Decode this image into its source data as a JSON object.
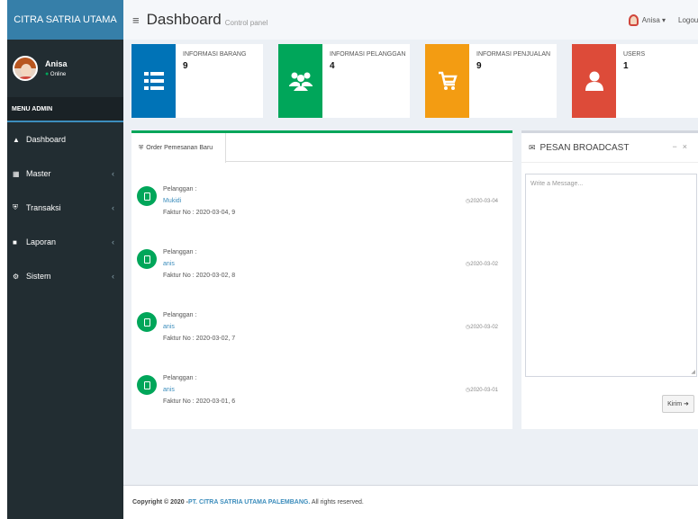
{
  "sidebar": {
    "brand": "CITRA SATRIA UTAMA",
    "user": {
      "name": "Anisa",
      "status": "Online"
    },
    "menu_header": "MENU ADMIN",
    "items": [
      {
        "label": "Dashboard",
        "icon": "dashboard-icon",
        "has_submenu": false
      },
      {
        "label": "Master",
        "icon": "th-icon",
        "has_submenu": true
      },
      {
        "label": "Transaksi",
        "icon": "cart-icon",
        "has_submenu": true
      },
      {
        "label": "Laporan",
        "icon": "book-icon",
        "has_submenu": true
      },
      {
        "label": "Sistem",
        "icon": "gear-icon",
        "has_submenu": true
      }
    ]
  },
  "header": {
    "title": "Dashboard",
    "subtitle": "Control panel",
    "user_label": "Anisa ▾",
    "logout_label": "Logout"
  },
  "info_boxes": [
    {
      "title": "INFORMASI BARANG",
      "value": "9",
      "color": "#0073b7",
      "icon": "list-icon"
    },
    {
      "title": "INFORMASI PELANGGAN",
      "value": "4",
      "color": "#00a65a",
      "icon": "users-icon"
    },
    {
      "title": "INFORMASI PENJUALAN",
      "value": "9",
      "color": "#f39c12",
      "icon": "cart-icon"
    },
    {
      "title": "USERS",
      "value": "1",
      "color": "#dd4b39",
      "icon": "user-icon"
    }
  ],
  "orders": {
    "tab_label": "Order Pemesanan Baru",
    "items": [
      {
        "label": "Pelanggan :",
        "name": "Mukidi",
        "faktur": "Faktur No : 2020-03-04, 9",
        "date": "2020-03-04"
      },
      {
        "label": "Pelanggan :",
        "name": "anis",
        "faktur": "Faktur No : 2020-03-02, 8",
        "date": "2020-03-02"
      },
      {
        "label": "Pelanggan :",
        "name": "anis",
        "faktur": "Faktur No : 2020-03-02, 7",
        "date": "2020-03-02"
      },
      {
        "label": "Pelanggan :",
        "name": "anis",
        "faktur": "Faktur No : 2020-03-01, 6",
        "date": "2020-03-01"
      }
    ]
  },
  "broadcast": {
    "title": "PESAN BROADCAST",
    "placeholder": "Write a Message...",
    "send_label": "Kirim"
  },
  "footer": {
    "prefix": "Copyright © 2020 - ",
    "company": "PT. CITRA SATRIA UTAMA PALEMBANG.",
    "suffix": " All rights reserved."
  },
  "colors": {
    "sidebar_bg": "#222d32",
    "brand_bg": "#367fa9",
    "accent": "#3c8dbc",
    "success": "#00a65a"
  }
}
